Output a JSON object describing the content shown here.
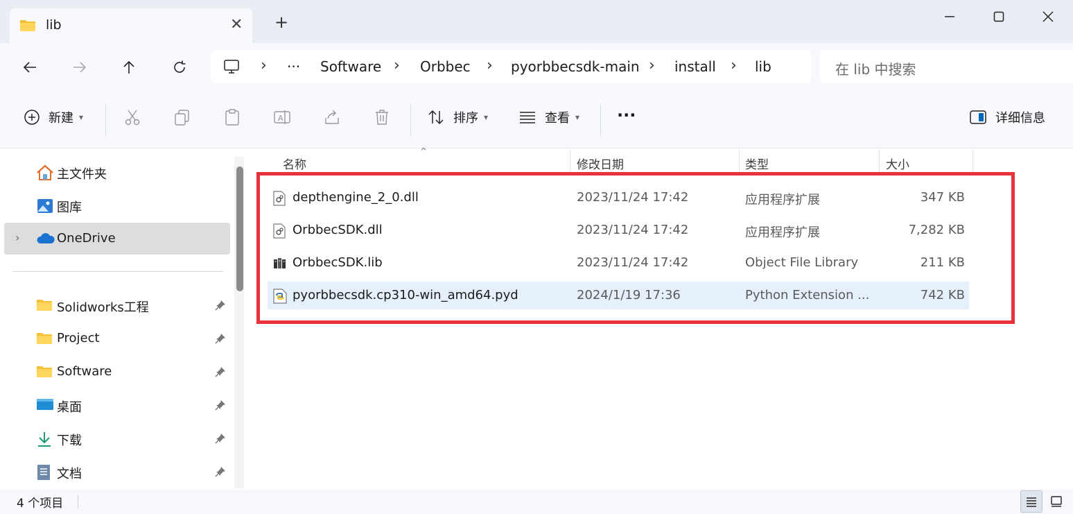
{
  "window": {
    "tab_title": "lib",
    "new_tab_symbol": "+"
  },
  "navigation": {
    "breadcrumbs": [
      "Software",
      "Orbbec",
      "pyorbbecsdk-main",
      "install",
      "lib"
    ],
    "overflow": "···",
    "search_placeholder": "在 lib 中搜索"
  },
  "toolbar": {
    "new_label": "新建",
    "sort_label": "排序",
    "view_label": "查看",
    "more_label": "···",
    "details_label": "详细信息"
  },
  "sidebar": {
    "items": [
      {
        "label": "主文件夹",
        "icon": "home-icon"
      },
      {
        "label": "图库",
        "icon": "gallery-icon"
      },
      {
        "label": "OneDrive",
        "icon": "onedrive-icon",
        "selected": true
      },
      {
        "label": "Solidworks工程",
        "icon": "folder-icon",
        "pinned": true
      },
      {
        "label": "Project",
        "icon": "folder-icon",
        "pinned": true
      },
      {
        "label": "Software",
        "icon": "folder-icon",
        "pinned": true
      },
      {
        "label": "桌面",
        "icon": "desktop-icon",
        "pinned": true
      },
      {
        "label": "下载",
        "icon": "download-icon",
        "pinned": true
      },
      {
        "label": "文档",
        "icon": "documents-icon",
        "pinned": true
      }
    ]
  },
  "file_list": {
    "columns": {
      "name": "名称",
      "modified": "修改日期",
      "type": "类型",
      "size": "大小"
    },
    "files": [
      {
        "name": "depthengine_2_0.dll",
        "modified": "2023/11/24 17:42",
        "type": "应用程序扩展",
        "size": "347 KB",
        "icon": "dll-icon"
      },
      {
        "name": "OrbbecSDK.dll",
        "modified": "2023/11/24 17:42",
        "type": "应用程序扩展",
        "size": "7,282 KB",
        "icon": "dll-icon"
      },
      {
        "name": "OrbbecSDK.lib",
        "modified": "2023/11/24 17:42",
        "type": "Object File Library",
        "size": "211 KB",
        "icon": "lib-icon"
      },
      {
        "name": "pyorbbecsdk.cp310-win_amd64.pyd",
        "modified": "2024/1/19 17:36",
        "type": "Python Extension ...",
        "size": "742 KB",
        "icon": "python-icon",
        "selected": true
      }
    ]
  },
  "status": {
    "item_count": "4 个项目"
  },
  "colors": {
    "highlight_border": "#e8323c",
    "selected_row": "#e5f0fb",
    "titlebar": "#e9eef5"
  }
}
